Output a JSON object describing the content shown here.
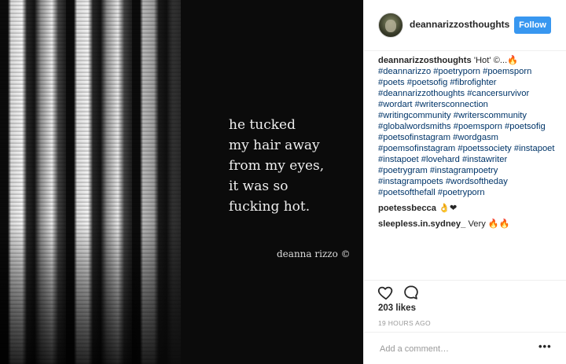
{
  "post": {
    "poem_lines": [
      "he tucked",
      "my hair away",
      "from my eyes,",
      "it was so",
      "fucking hot."
    ],
    "signature": "deanna rizzo ©"
  },
  "header": {
    "username": "deannarizzosthoughts",
    "follow_label": "Follow"
  },
  "caption": {
    "user": "deannarizzosthoughts",
    "text": "'Hot' ©...🔥",
    "hashtags": "#deannarizzo #poetryporn #poemsporn #poets #poetsofig #fibrofighter #deannarizzothoughts #cancersurvivor #wordart #writersconnection #writingcommunity #writerscommunity #globalwordsmiths #poemsporn #poetsofig #poetsofinstagram #wordgasm #poemsofinstagram #poetssociety #instapoet #instapoet #lovehard #instawriter #poetrygram #instagrampoetry #instagrampoets #wordsoftheday #poetsofthefall #poetryporn"
  },
  "comments": [
    {
      "user": "poetessbecca",
      "text": "👌❤"
    },
    {
      "user": "sleepless.in.sydney_",
      "text": "Very 🔥🔥"
    }
  ],
  "actions": {
    "like_icon": "heart-icon",
    "comment_icon": "comment-icon"
  },
  "likes": "203 likes",
  "timestamp": "19 HOURS AGO",
  "add_comment": {
    "placeholder": "Add a comment…",
    "more_label": "•••"
  },
  "colors": {
    "accent": "#3897f0",
    "link": "#003569",
    "text": "#262626",
    "muted": "#999999"
  }
}
